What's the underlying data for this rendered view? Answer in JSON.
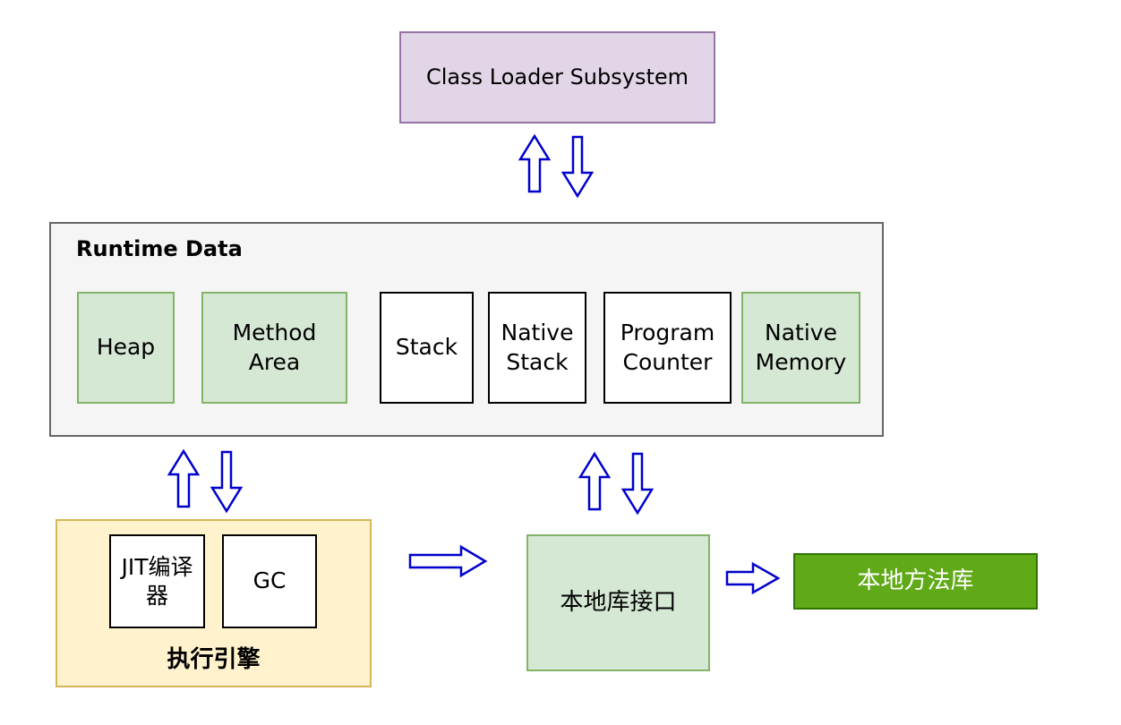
{
  "class_loader": {
    "label": "Class Loader Subsystem"
  },
  "runtime_data": {
    "title": "Runtime Data",
    "heap": "Heap",
    "method_area": "Method\nArea",
    "stack": "Stack",
    "native_stack": "Native\nStack",
    "program_counter": "Program\nCounter",
    "native_memory": "Native\nMemory"
  },
  "execution_engine": {
    "title": "执行引擎",
    "jit": "JIT编译\n器",
    "gc": "GC"
  },
  "native_interface": {
    "label": "本地库接口"
  },
  "native_library": {
    "label": "本地方法库"
  },
  "colors": {
    "arrow_stroke": "#0000cc",
    "class_loader_fill": "#e1d5e7",
    "runtime_fill": "#f5f5f5",
    "green_fill": "#d5e8d4",
    "engine_fill": "#fff2cc",
    "native_library_fill": "#60a917"
  }
}
